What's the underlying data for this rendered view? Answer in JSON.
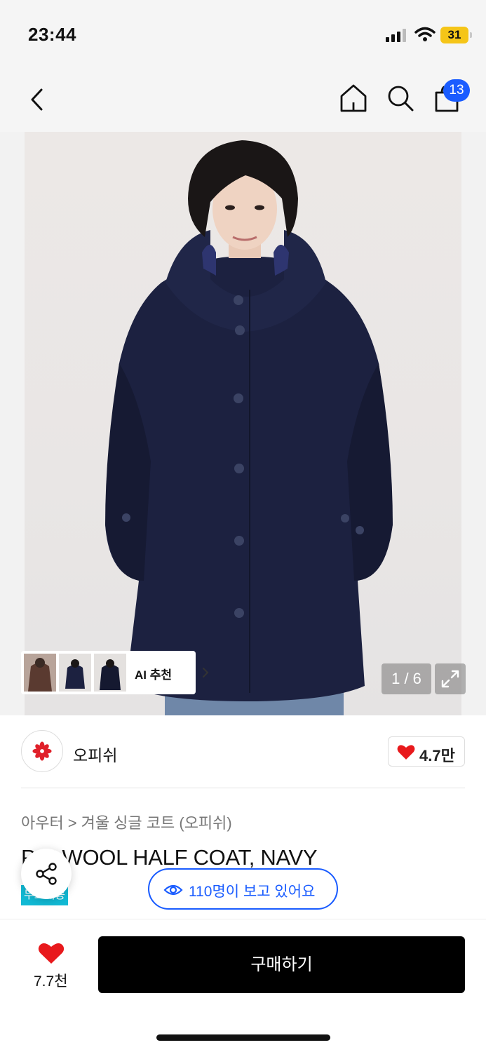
{
  "status_bar": {
    "time": "23:44",
    "battery": "31"
  },
  "nav": {
    "cart_count": "13",
    "icons": [
      "back-icon",
      "home-icon",
      "search-icon",
      "cart-icon"
    ]
  },
  "gallery": {
    "ai_label": "AI 추천",
    "page_indicator": "1 / 6"
  },
  "brand": {
    "name": "오피쉬",
    "likes": "4.7만"
  },
  "breadcrumb": {
    "category": "아우터",
    "separator": ">",
    "sub": "겨울 싱글 코트 (오피쉬)"
  },
  "product": {
    "title": "P    H WOOL HALF COAT, NAVY",
    "badge": "무료배송"
  },
  "viewers": {
    "text": "110명이 보고 있어요"
  },
  "bottom": {
    "favorite_count": "7.7천",
    "buy_label": "구매하기"
  },
  "colors": {
    "accent": "#1a5cff",
    "badge": "#11b9d4",
    "heart": "#e8191c",
    "battery": "#f5c518",
    "coat": "#1c2140"
  }
}
